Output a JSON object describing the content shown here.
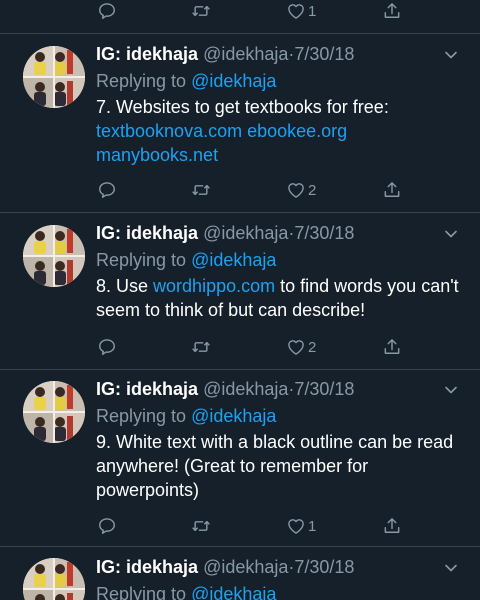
{
  "top_actions": {
    "like_count": "1"
  },
  "tweets": [
    {
      "display_name": "IG: idekhaja",
      "handle": "@idekhaja",
      "date": "7/30/18",
      "replying_to_label": "Replying to",
      "replying_to_handle": "@idekhaja",
      "text_before": "7. Websites to get textbooks for free:",
      "links": [
        "textbooknova.com",
        "ebookee.org",
        "manybooks.net"
      ],
      "like_count": "2"
    },
    {
      "display_name": "IG: idekhaja",
      "handle": "@idekhaja",
      "date": "7/30/18",
      "replying_to_label": "Replying to",
      "replying_to_handle": "@idekhaja",
      "text_before": "8. Use",
      "link": "wordhippo.com",
      "text_after": "to find words you can't seem to think of but can describe!",
      "like_count": "2"
    },
    {
      "display_name": "IG: idekhaja",
      "handle": "@idekhaja",
      "date": "7/30/18",
      "replying_to_label": "Replying to",
      "replying_to_handle": "@idekhaja",
      "text": "9. White text with a black outline can be read anywhere! (Great to remember for powerpoints)",
      "like_count": "1"
    },
    {
      "display_name": "IG: idekhaja",
      "handle": "@idekhaja",
      "date": "7/30/18",
      "replying_to_label": "Replying to",
      "replying_to_handle": "@idekhaja"
    }
  ],
  "colors": {
    "background": "#15202b",
    "divider": "#38444d",
    "secondary_text": "#8899a6",
    "link": "#1da1f2"
  },
  "icons": [
    "reply-icon",
    "retweet-icon",
    "like-icon",
    "share-icon",
    "chevron-down-icon",
    "avatar"
  ]
}
